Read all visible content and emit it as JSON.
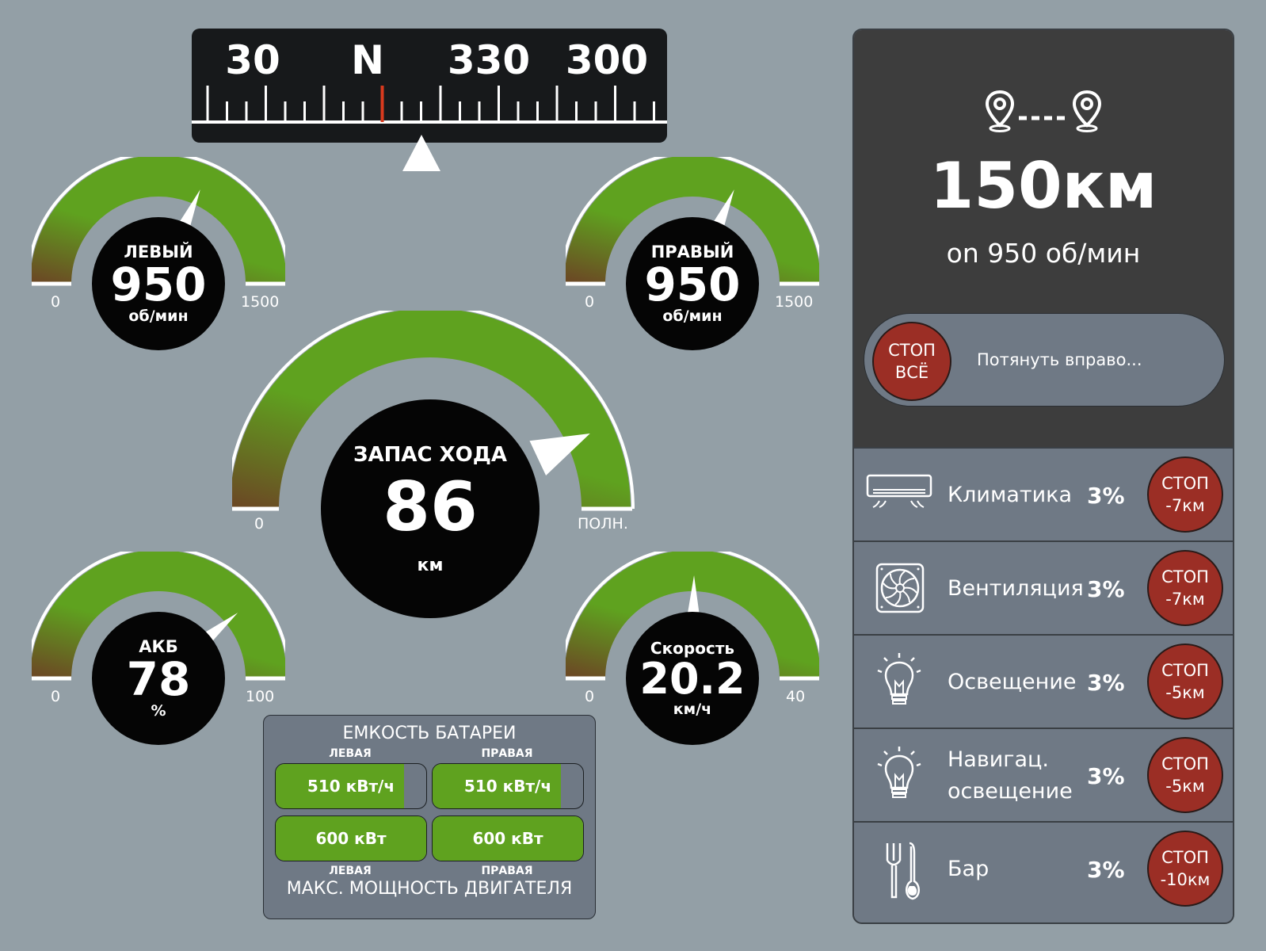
{
  "compass": {
    "labels": [
      "30",
      "N",
      "330",
      "300"
    ],
    "heading_marker_color": "#d93a1e"
  },
  "gauges": {
    "left_engine": {
      "label": "ЛЕВЫЙ",
      "value": "950",
      "unit": "об/мин",
      "min": "0",
      "max": "1500",
      "fraction": 0.633
    },
    "right_engine": {
      "label": "ПРАВЫЙ",
      "value": "950",
      "unit": "об/мин",
      "min": "0",
      "max": "1500",
      "fraction": 0.633
    },
    "range": {
      "label": "ЗАПАС ХОДА",
      "value": "86",
      "unit": "км",
      "min": "0",
      "max": "ПОЛН.",
      "fraction": 0.86
    },
    "battery": {
      "label": "АКБ",
      "value": "78",
      "unit": "%",
      "min": "0",
      "max": "100",
      "fraction": 0.78
    },
    "speed": {
      "label": "Скорость",
      "value": "20.2",
      "unit": "км/ч",
      "min": "0",
      "max": "40",
      "fraction": 0.505
    }
  },
  "battery_panel": {
    "title": "ЕМКОСТЬ БАТАРЕИ",
    "left_label": "ЛЕВАЯ",
    "right_label": "ПРАВАЯ",
    "capacity_left": "510 кВт/ч",
    "capacity_right": "510 кВт/ч",
    "capacity_fill": 0.85,
    "power_left": "600 кВт",
    "power_right": "600 кВт",
    "power_fill": 1.0,
    "footer": "МАКС. МОЩНОСТЬ ДВИГАТЕЛЯ"
  },
  "route": {
    "range": "150км",
    "subtitle": "on 950 об/мин",
    "stop_all_line1": "СТОП",
    "stop_all_line2": "ВСЁ",
    "slider_hint": "Потянуть вправо..."
  },
  "consumers": [
    {
      "name": "Климатика",
      "name2": "",
      "percent": "3%",
      "stop": "СТОП",
      "range_loss": "-7км",
      "icon": "air-conditioner-icon"
    },
    {
      "name": "Вентиляция",
      "name2": "",
      "percent": "3%",
      "stop": "СТОП",
      "range_loss": "-7км",
      "icon": "fan-icon"
    },
    {
      "name": "Освещение",
      "name2": "",
      "percent": "3%",
      "stop": "СТОП",
      "range_loss": "-5км",
      "icon": "bulb-icon"
    },
    {
      "name": "Навигац.",
      "name2": "освещение",
      "percent": "3%",
      "stop": "СТОП",
      "range_loss": "-5км",
      "icon": "bulb-icon"
    },
    {
      "name": "Бар",
      "name2": "",
      "percent": "3%",
      "stop": "СТОП",
      "range_loss": "-10км",
      "icon": "fork-spoon-icon"
    }
  ],
  "colors": {
    "accent": "#5fa21f",
    "low": "#6b4a24",
    "stop": "#9b2e25",
    "background": "#939fa6",
    "panel": "#6f7985"
  }
}
